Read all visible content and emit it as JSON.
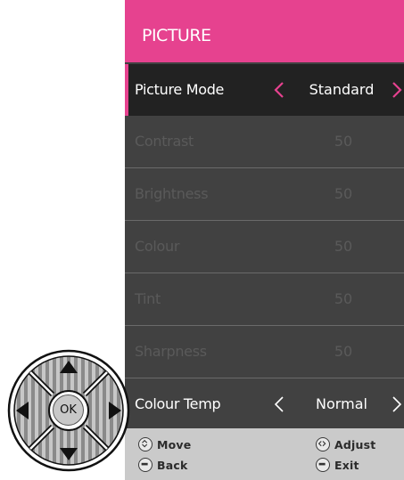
{
  "menu": {
    "title": "PICTURE",
    "rows": [
      {
        "label": "Picture Mode",
        "value": "Standard"
      },
      {
        "label": "Contrast",
        "value": "50"
      },
      {
        "label": "Brightness",
        "value": "50"
      },
      {
        "label": "Colour",
        "value": "50"
      },
      {
        "label": "Tint",
        "value": "50"
      },
      {
        "label": "Sharpness",
        "value": "50"
      },
      {
        "label": "Colour Temp",
        "value": "Normal"
      }
    ]
  },
  "footer": {
    "move": "Move",
    "adjust": "Adjust",
    "back": "Back",
    "exit": "Exit"
  },
  "remote": {
    "ok_label": "OK"
  },
  "colors": {
    "accent": "#e6428f",
    "panel": "#414141",
    "active_row": "#222222",
    "footer": "#cacaca"
  },
  "icons": {
    "left": "chevron-left-icon",
    "right": "chevron-right-icon",
    "move": "up-down-icon",
    "adjust": "left-right-icon",
    "back": "menu-button-icon",
    "exit": "exit-button-icon"
  }
}
